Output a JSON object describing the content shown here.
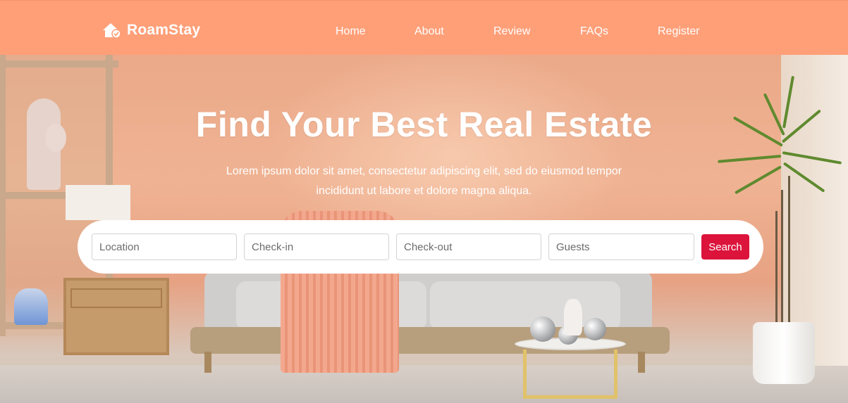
{
  "brand": {
    "name": "RoamStay",
    "icon": "house-check-icon"
  },
  "nav": {
    "items": [
      {
        "label": "Home"
      },
      {
        "label": "About"
      },
      {
        "label": "Review"
      },
      {
        "label": "FAQs"
      },
      {
        "label": "Register"
      }
    ]
  },
  "hero": {
    "title": "Find Your Best Real Estate",
    "subtitle": "Lorem ipsum dolor sit amet, consectetur adipiscing elit, sed do eiusmod tempor incididunt ut labore et dolore magna aliqua."
  },
  "search": {
    "location_placeholder": "Location",
    "checkin_placeholder": "Check-in",
    "checkout_placeholder": "Check-out",
    "guests_placeholder": "Guests",
    "button_label": "Search"
  },
  "colors": {
    "navbar": "#fe9f78",
    "accent": "#dc143c",
    "text_light": "#ffffff"
  }
}
